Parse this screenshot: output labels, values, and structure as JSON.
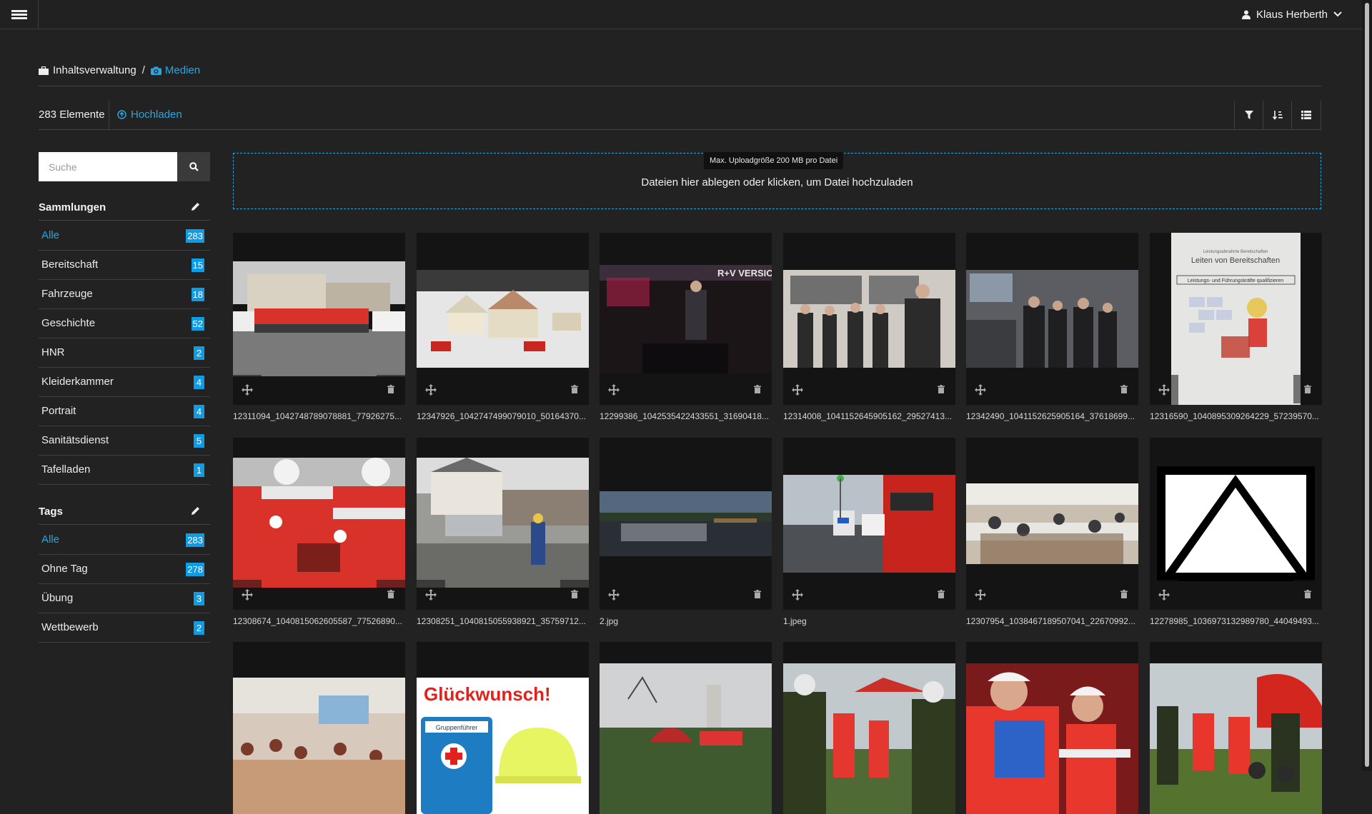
{
  "header": {
    "user_name": "Klaus Herberth"
  },
  "breadcrumb": {
    "home": "Inhaltsverwaltung",
    "separator": "/",
    "current": "Medien"
  },
  "toolbar": {
    "count": "283 Elemente",
    "upload": "Hochladen"
  },
  "search": {
    "placeholder": "Suche"
  },
  "collections": {
    "title": "Sammlungen",
    "items": [
      {
        "label": "Alle",
        "count": "283"
      },
      {
        "label": "Bereitschaft",
        "count": "15"
      },
      {
        "label": "Fahrzeuge",
        "count": "18"
      },
      {
        "label": "Geschichte",
        "count": "52"
      },
      {
        "label": "HNR",
        "count": "2"
      },
      {
        "label": "Kleiderkammer",
        "count": "4"
      },
      {
        "label": "Portrait",
        "count": "4"
      },
      {
        "label": "Sanitätsdienst",
        "count": "5"
      },
      {
        "label": "Tafelladen",
        "count": "1"
      }
    ]
  },
  "tags": {
    "title": "Tags",
    "items": [
      {
        "label": "Alle",
        "count": "283"
      },
      {
        "label": "Ohne Tag",
        "count": "278"
      },
      {
        "label": "Übung",
        "count": "3"
      },
      {
        "label": "Wettbewerb",
        "count": "2"
      }
    ]
  },
  "dropzone": {
    "tooltip": "Max. Uploadgröße 200 MB pro Datei",
    "message": "Dateien hier ablegen oder klicken, um Datei hochzuladen"
  },
  "files": [
    "12311094_1042748789078881_77926275...",
    "12347926_1042747499079010_50164370...",
    "12299386_1042535422433551_31690418...",
    "12314008_1041152645905162_29527413...",
    "12342490_1041152625905164_37618699...",
    "12316590_1040895309264229_57239570...",
    "12308674_1040815062605587_77526890...",
    "12308251_1040815055938921_35759712...",
    "2.jpg",
    "1.jpeg",
    "12307954_1038467189507041_22670992...",
    "12278985_1036973132989780_44049493...",
    "",
    "",
    "",
    "",
    "",
    ""
  ],
  "thumb_texts": {
    "poster_line1": "Leistungsabnahme Bereitschaften",
    "poster_title": "Leiten von Bereitschaften",
    "poster_box": "Leistungs- und Führungskräfte qualifizieren",
    "congrats": "Glückwunsch!",
    "badge": "Gruppenführer",
    "banner": "R+V VERSICH"
  },
  "colors": {
    "accent": "#29a6e0",
    "badge": "#0f9ce4",
    "background": "#222222"
  }
}
